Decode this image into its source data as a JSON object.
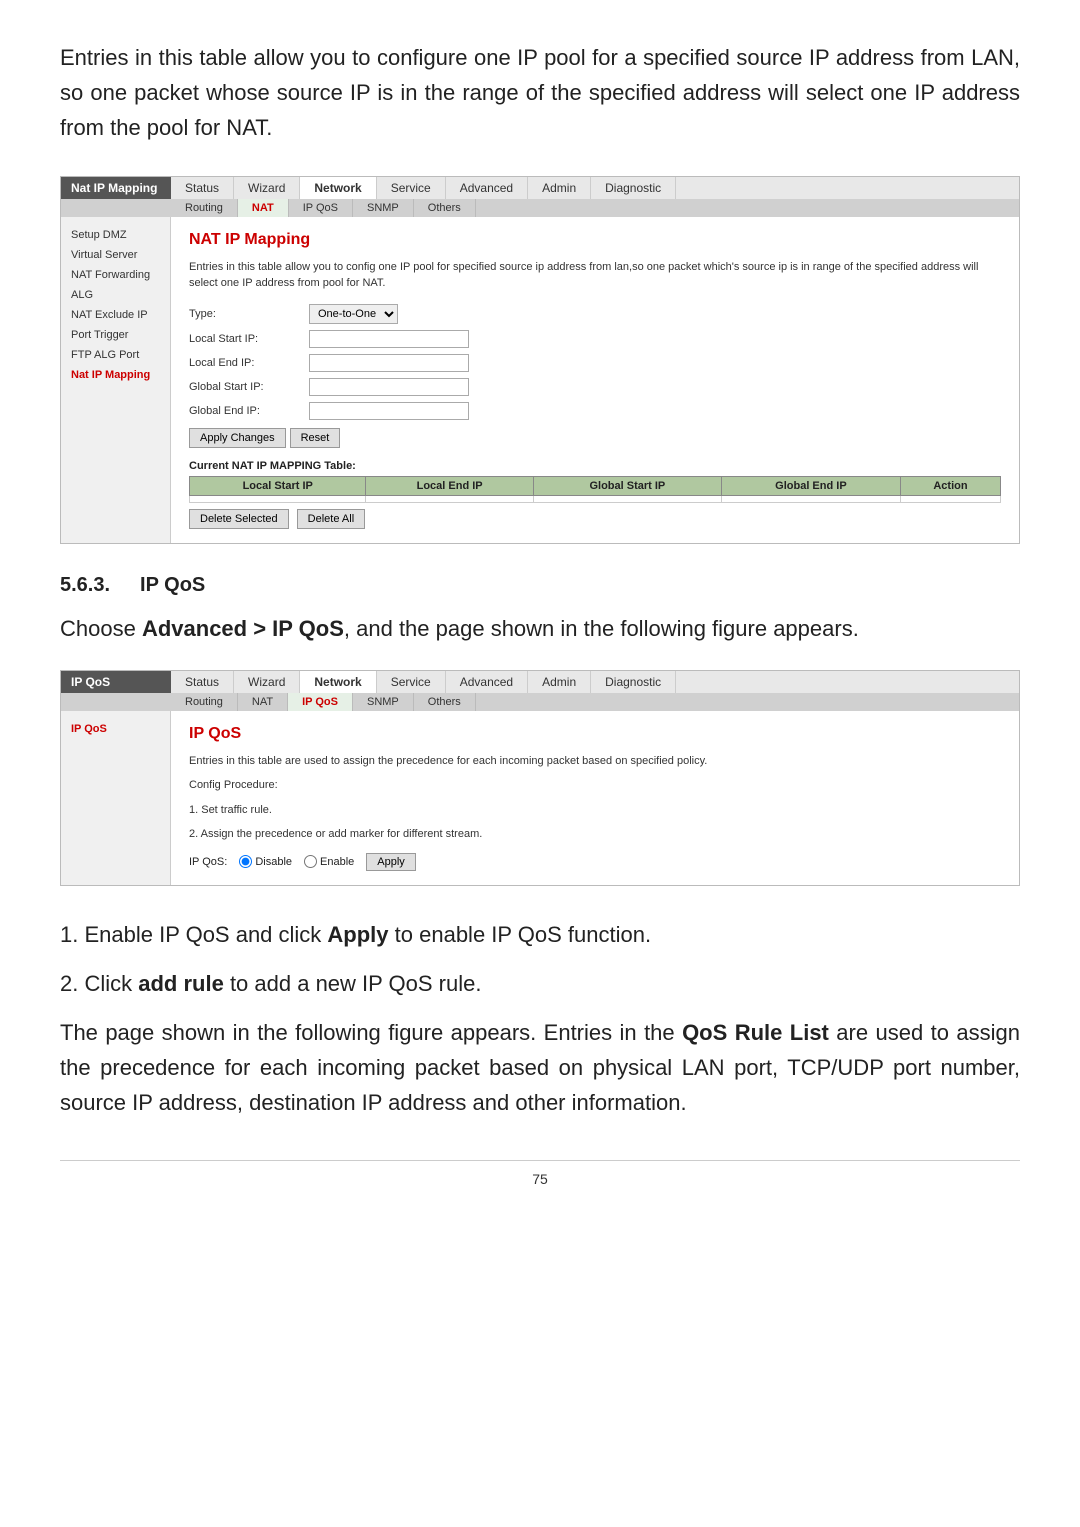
{
  "intro": {
    "text": "Entries in this table allow you to configure one IP pool for a specified source IP address from LAN, so one packet whose source IP is in the range of the specified address will select one IP address from the pool for NAT."
  },
  "nat_panel": {
    "label": "Nat IP Mapping",
    "nav": {
      "tabs": [
        {
          "label": "Status",
          "active": false
        },
        {
          "label": "Wizard",
          "active": false
        },
        {
          "label": "Network",
          "active": true
        },
        {
          "label": "Service",
          "active": false
        },
        {
          "label": "Advanced",
          "active": false
        },
        {
          "label": "Admin",
          "active": false
        },
        {
          "label": "Diagnostic",
          "active": false
        }
      ],
      "sub_tabs": [
        {
          "label": "Routing",
          "active": false
        },
        {
          "label": "NAT",
          "active": true
        },
        {
          "label": "IP QoS",
          "active": false
        },
        {
          "label": "SNMP",
          "active": false
        },
        {
          "label": "Others",
          "active": false
        }
      ]
    },
    "sidebar": [
      {
        "label": "Setup DMZ",
        "active": false
      },
      {
        "label": "Virtual Server",
        "active": false
      },
      {
        "label": "NAT Forwarding",
        "active": false
      },
      {
        "label": "ALG",
        "active": false
      },
      {
        "label": "NAT Exclude IP",
        "active": false
      },
      {
        "label": "Port Trigger",
        "active": false
      },
      {
        "label": "FTP ALG Port",
        "active": false
      },
      {
        "label": "Nat IP Mapping",
        "active": true
      }
    ],
    "content": {
      "title": "NAT IP Mapping",
      "desc": "Entries in this table allow you to config one IP pool for specified source ip address from lan,so one packet which's source ip is in range of the specified address will select one IP address from pool for NAT.",
      "type_label": "Type:",
      "type_value": "One-to-One",
      "local_start_label": "Local Start IP:",
      "local_end_label": "Local End IP:",
      "global_start_label": "Global Start IP:",
      "global_end_label": "Global End IP:",
      "btn_apply": "Apply Changes",
      "btn_reset": "Reset",
      "table_label": "Current NAT IP MAPPING Table:",
      "table_headers": [
        "Local Start IP",
        "Local End IP",
        "Global Start IP",
        "Global End IP",
        "Action"
      ],
      "btn_delete_selected": "Delete Selected",
      "btn_delete_all": "Delete All"
    }
  },
  "section_563": {
    "number": "5.6.3.",
    "title": "IP QoS",
    "intro": "Choose Advanced > IP QoS, and the page shown in the following figure appears."
  },
  "qos_panel": {
    "label": "IP QoS",
    "nav": {
      "tabs": [
        {
          "label": "Status",
          "active": false
        },
        {
          "label": "Wizard",
          "active": false
        },
        {
          "label": "Network",
          "active": true
        },
        {
          "label": "Service",
          "active": false
        },
        {
          "label": "Advanced",
          "active": false
        },
        {
          "label": "Admin",
          "active": false
        },
        {
          "label": "Diagnostic",
          "active": false
        }
      ],
      "sub_tabs": [
        {
          "label": "Routing",
          "active": false
        },
        {
          "label": "NAT",
          "active": false
        },
        {
          "label": "IP QoS",
          "active": true
        },
        {
          "label": "SNMP",
          "active": false
        },
        {
          "label": "Others",
          "active": false
        }
      ]
    },
    "sidebar": [
      {
        "label": "IP QoS",
        "active": true
      }
    ],
    "content": {
      "title": "IP QoS",
      "desc1": "Entries in this table are used to assign the precedence for each incoming packet based on specified policy.",
      "config_label": "Config Procedure:",
      "step1": "1. Set traffic rule.",
      "step2": "2. Assign the precedence or add marker for different stream.",
      "qos_label": "IP QoS:",
      "radio_disable": "Disable",
      "radio_enable": "Enable",
      "btn_apply": "Apply"
    }
  },
  "body_sections": [
    {
      "number": "1.",
      "text": "Enable IP QoS and click",
      "bold": "Apply",
      "rest": "to enable IP QoS function."
    },
    {
      "number": "2.",
      "text": "Click",
      "bold": "add rule",
      "rest": "to add a new IP QoS rule."
    }
  ],
  "final_para": "The page shown in the following figure appears. Entries in the QoS Rule List are used to assign the precedence for each incoming packet based on physical LAN port, TCP/UDP port number, source IP address, destination IP address and other information.",
  "final_para_bold": "QoS Rule List",
  "page_number": "75"
}
